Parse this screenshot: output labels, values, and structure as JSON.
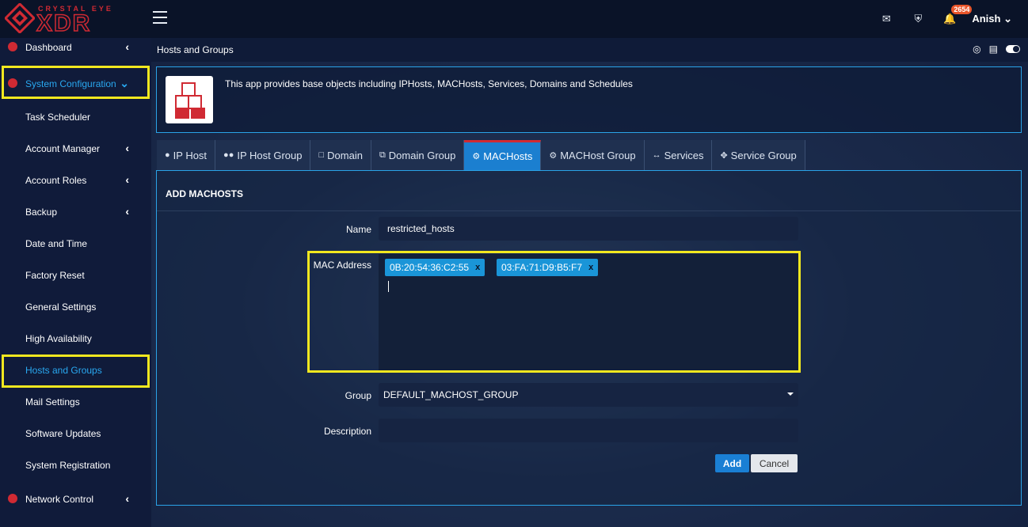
{
  "brand": {
    "small": "CRYSTAL EYE",
    "big": "XDR"
  },
  "topbar": {
    "notification_count": "2654",
    "user_name": "Anish"
  },
  "sidebar": {
    "items": [
      {
        "label": "Dashboard"
      },
      {
        "label": "System Configuration"
      },
      {
        "label": "Task Scheduler"
      },
      {
        "label": "Account Manager"
      },
      {
        "label": "Account Roles"
      },
      {
        "label": "Backup"
      },
      {
        "label": "Date and Time"
      },
      {
        "label": "Factory Reset"
      },
      {
        "label": "General Settings"
      },
      {
        "label": "High Availability"
      },
      {
        "label": "Hosts and Groups"
      },
      {
        "label": "Mail Settings"
      },
      {
        "label": "Software Updates"
      },
      {
        "label": "System Registration"
      },
      {
        "label": "Network Control"
      }
    ]
  },
  "page": {
    "title": "Hosts and Groups",
    "description": "This app provides base objects including IPHosts, MACHosts, Services, Domains and Schedules"
  },
  "tabs": [
    {
      "label": "IP Host",
      "icon": "user-icon"
    },
    {
      "label": "IP Host Group",
      "icon": "users-icon"
    },
    {
      "label": "Domain",
      "icon": "file-icon"
    },
    {
      "label": "Domain Group",
      "icon": "files-icon"
    },
    {
      "label": "MACHosts",
      "icon": "gear-icon"
    },
    {
      "label": "MACHost Group",
      "icon": "gears-icon"
    },
    {
      "label": "Services",
      "icon": "arrows-h-icon"
    },
    {
      "label": "Service Group",
      "icon": "arrows-icon"
    }
  ],
  "form": {
    "heading": "ADD MACHOSTS",
    "name_label": "Name",
    "name_value": "restricted_hosts",
    "mac_label": "MAC Address",
    "mac_tags": [
      "0B:20:54:36:C2:55",
      "03:FA:71:D9:B5:F7"
    ],
    "tag_remove": "x",
    "group_label": "Group",
    "group_value": "DEFAULT_MACHOST_GROUP",
    "description_label": "Description",
    "description_value": "",
    "add_label": "Add",
    "cancel_label": "Cancel"
  },
  "colors": {
    "accent": "#1b7fd0",
    "brand_red": "#d02a33",
    "highlight": "#f2e81f"
  }
}
